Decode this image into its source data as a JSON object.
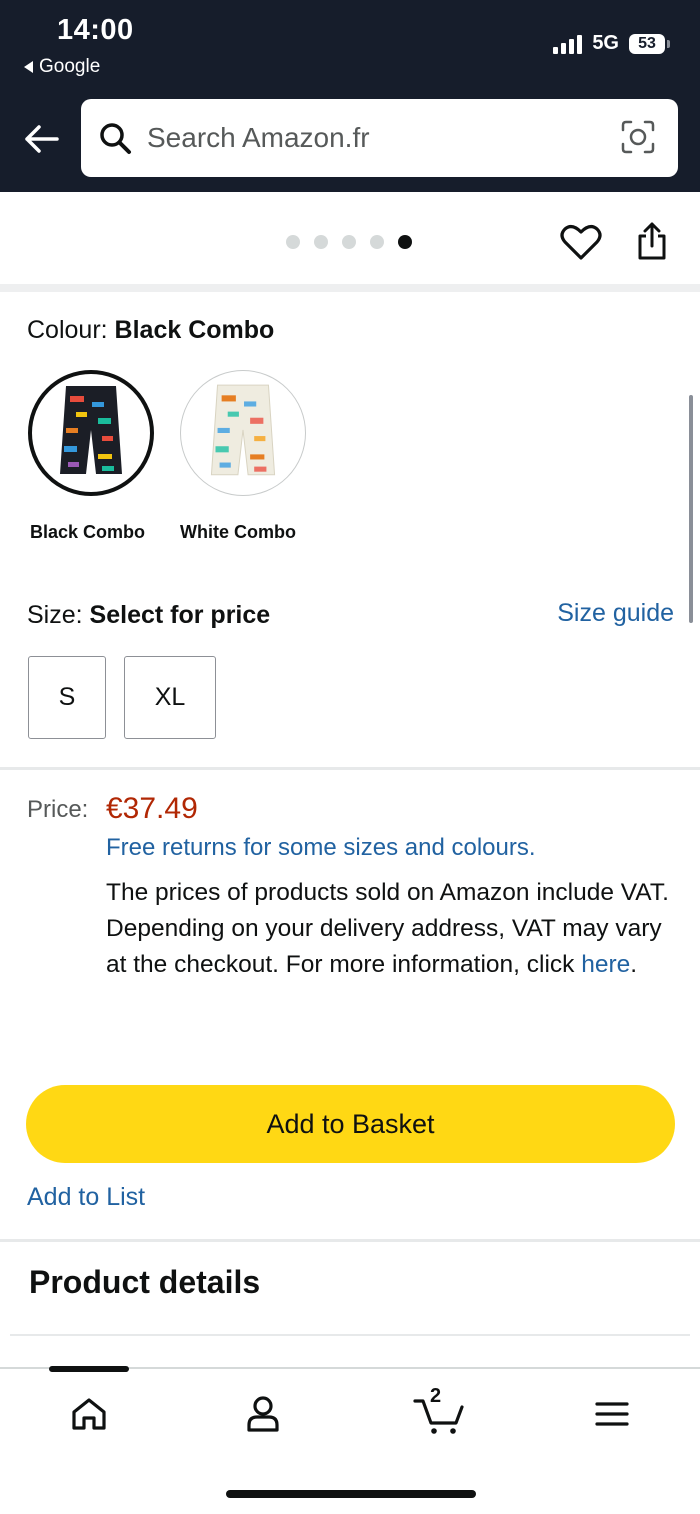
{
  "status_bar": {
    "time": "14:00",
    "back_app": "Google",
    "network": "5G",
    "battery": "53"
  },
  "search": {
    "placeholder": "Search Amazon.fr"
  },
  "image_gallery": {
    "dot_count": 5,
    "active_dot": 5
  },
  "colour": {
    "label": "Colour:",
    "selected": "Black Combo",
    "options": [
      {
        "name": "Black Combo",
        "selected": true
      },
      {
        "name": "White Combo",
        "selected": false
      }
    ]
  },
  "size": {
    "label": "Size:",
    "value": "Select for price",
    "guide": "Size guide",
    "options": [
      "S",
      "XL"
    ]
  },
  "price": {
    "label": "Price:",
    "amount": "€37.49",
    "free_returns": "Free returns for some sizes and colours.",
    "vat_text": "The prices of products sold on Amazon include VAT. Depending on your delivery address, VAT may vary at the checkout. For more information, click",
    "vat_link": "here",
    "vat_end": "."
  },
  "actions": {
    "add_to_basket": "Add to Basket",
    "add_to_list": "Add to List"
  },
  "product_details": {
    "title": "Product details"
  },
  "bottom_nav": {
    "cart_count": "2",
    "items": [
      "home-icon",
      "account-icon",
      "cart-icon",
      "menu-icon"
    ]
  },
  "colors": {
    "header_bg": "#161d2b",
    "price": "#b12704",
    "link": "#2162a1",
    "button": "#ffd814"
  }
}
